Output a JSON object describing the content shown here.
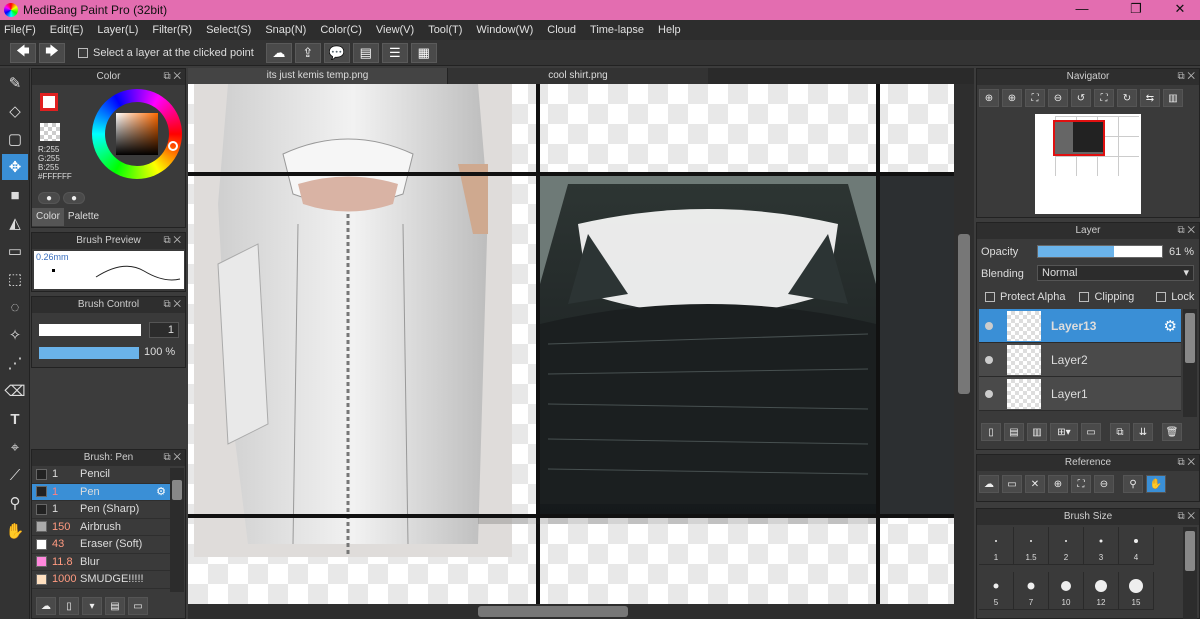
{
  "window": {
    "title": "MediBang Paint Pro (32bit)",
    "min": "—",
    "max": "❐",
    "close": "✕"
  },
  "menu": [
    "File(F)",
    "Edit(E)",
    "Layer(L)",
    "Filter(R)",
    "Select(S)",
    "Snap(N)",
    "Color(C)",
    "View(V)",
    "Tool(T)",
    "Window(W)",
    "Cloud",
    "Time-lapse",
    "Help"
  ],
  "toolbar": {
    "undo": "🡄",
    "redo": "🡆",
    "select_layer_label": "Select a layer at the clicked point"
  },
  "tabs": [
    {
      "label": "its just kemis temp.png"
    },
    {
      "label": "cool shirt.png"
    }
  ],
  "color_panel": {
    "title": "Color",
    "rgb": [
      "R:255",
      "G:255",
      "B:255"
    ],
    "hex": "#FFFFFF",
    "tab_color": "Color",
    "tab_palette": "Palette"
  },
  "brush_preview": {
    "title": "Brush Preview",
    "size": "0.26mm"
  },
  "brush_control": {
    "title": "Brush Control",
    "size_value": "1",
    "opacity_value": "100 %",
    "opacity": 1.0
  },
  "brush_panel": {
    "title": "Brush: Pen",
    "items": [
      {
        "size": "1",
        "name": "Pencil",
        "color": "#222222",
        "selected": false
      },
      {
        "size": "1",
        "name": "Pen",
        "color": "#222222",
        "selected": true
      },
      {
        "size": "1",
        "name": "Pen (Sharp)",
        "color": "#222222",
        "selected": false
      },
      {
        "size": "150",
        "name": "Airbrush",
        "color": "#aaaaaa",
        "selected": false
      },
      {
        "size": "43",
        "name": "Eraser (Soft)",
        "color": "#ffffff",
        "selected": false
      },
      {
        "size": "11.8",
        "name": "Blur",
        "color": "#ff88dd",
        "selected": false
      },
      {
        "size": "1000",
        "name": "SMUDGE!!!!!",
        "color": "#ffe0c0",
        "selected": false
      }
    ]
  },
  "navigator": {
    "title": "Navigator"
  },
  "layer_panel": {
    "title": "Layer",
    "opacity_label": "Opacity",
    "opacity_value": "61 %",
    "opacity": 0.61,
    "blending_label": "Blending",
    "blending_value": "Normal",
    "protect_alpha": "Protect Alpha",
    "clipping": "Clipping",
    "lock": "Lock",
    "layers": [
      {
        "name": "Layer13",
        "selected": true
      },
      {
        "name": "Layer2",
        "selected": false
      },
      {
        "name": "Layer1",
        "selected": false
      }
    ]
  },
  "reference": {
    "title": "Reference"
  },
  "brush_size": {
    "title": "Brush Size",
    "sizes": [
      "1",
      "1.5",
      "2",
      "3",
      "4",
      "5",
      "7",
      "10",
      "12",
      "15"
    ]
  },
  "colors": {
    "accent": "#3a8fd6",
    "titlebar": "#e36db0"
  }
}
